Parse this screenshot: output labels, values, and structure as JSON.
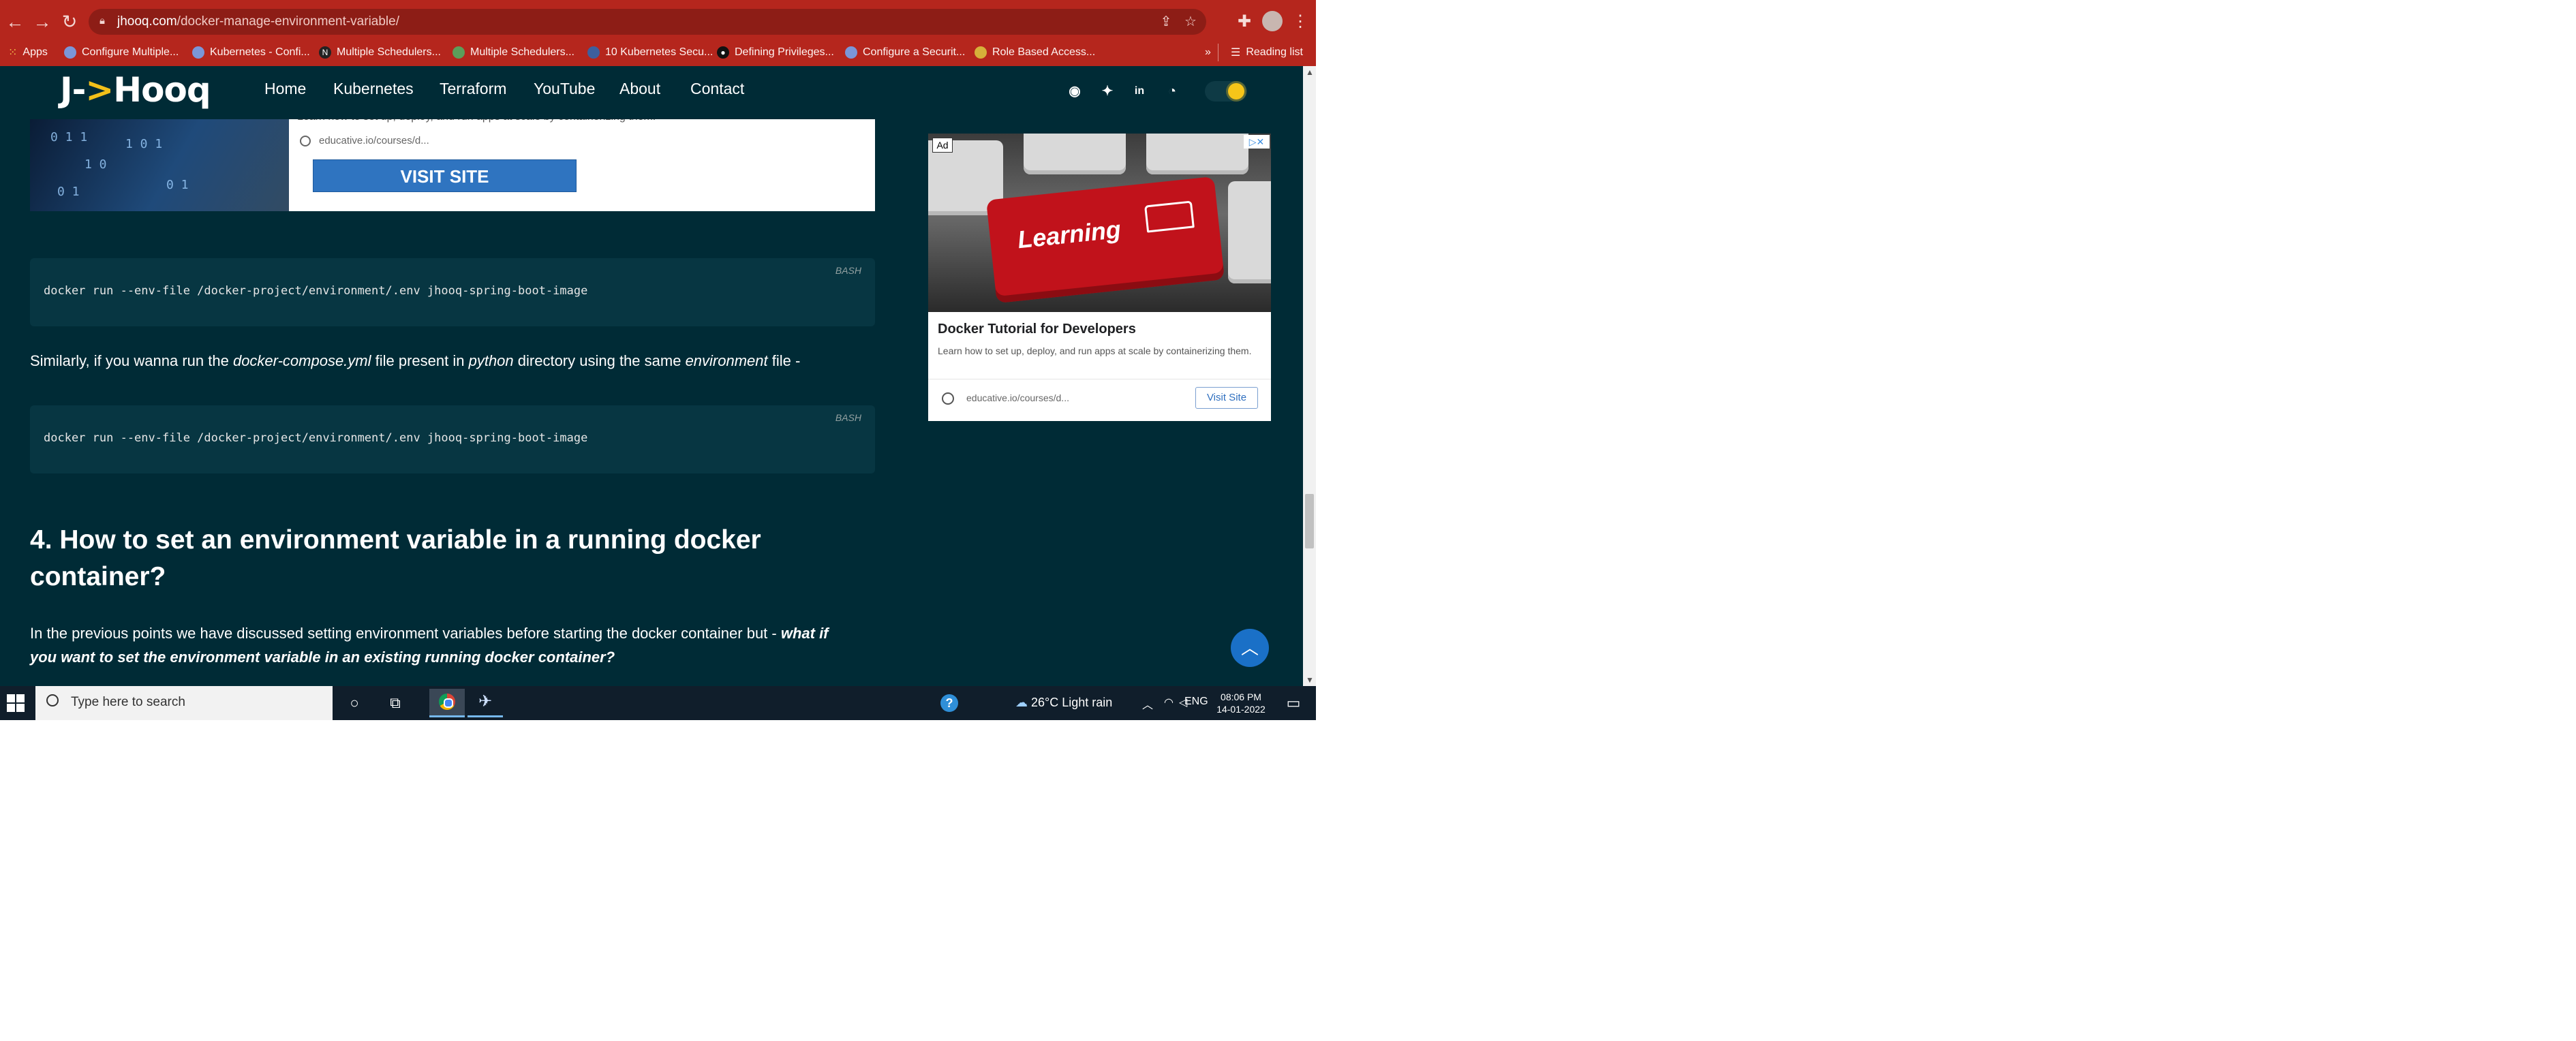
{
  "browser": {
    "url_domain": "jhooq.com",
    "url_path": "/docker-manage-environment-variable/",
    "bookmarks": [
      {
        "label": "Apps"
      },
      {
        "label": "Configure Multiple..."
      },
      {
        "label": "Kubernetes - Confi..."
      },
      {
        "label": "Multiple Schedulers..."
      },
      {
        "label": "Multiple Schedulers..."
      },
      {
        "label": "10 Kubernetes Secu..."
      },
      {
        "label": "Defining Privileges..."
      },
      {
        "label": "Configure a Securit..."
      },
      {
        "label": "Role Based Access..."
      }
    ],
    "more": "»",
    "reading_list": "Reading list"
  },
  "site": {
    "logo_left": "J-",
    "logo_arrow": ">",
    "logo_right": "Hooq",
    "menu": [
      "Home",
      "Kubernetes",
      "Terraform",
      "YouTube",
      "About",
      "Contact"
    ]
  },
  "top_ad": {
    "description": "Learn how to set up, deploy, and run apps at scale by containerizing them.",
    "url": "educative.io/courses/d...",
    "button": "VISIT SITE"
  },
  "article": {
    "code1": {
      "lang": "BASH",
      "text": "docker run --env-file /docker-project/environment/.env jhooq-spring-boot-image"
    },
    "para1": {
      "a": "Similarly, if you wanna run the ",
      "b": "docker-compose.yml",
      "c": " file present in ",
      "d": "python",
      "e": " directory using the same ",
      "f": "environment",
      "g": " file -"
    },
    "code2": {
      "lang": "BASH",
      "text": "docker run --env-file /docker-project/environment/.env jhooq-spring-boot-image"
    },
    "heading": "4. How to set an environment variable in a running docker container?",
    "para2": {
      "a": "In the previous points we have discussed setting environment variables before starting the docker container but - ",
      "b": "what if",
      "c": "you want to set the environment variable in an existing running docker container?"
    }
  },
  "side_ad": {
    "badge": "Ad",
    "image_text": "Learning",
    "title": "Docker Tutorial for Developers",
    "description": "Learn how to set up, deploy, and run apps at scale by containerizing them.",
    "url": "educative.io/courses/d...",
    "button": "Visit Site"
  },
  "taskbar": {
    "search_placeholder": "Type here to search",
    "weather": "26°C  Light rain",
    "language": "ENG",
    "time": "08:06 PM",
    "date": "14-01-2022",
    "notification_count": "1"
  }
}
